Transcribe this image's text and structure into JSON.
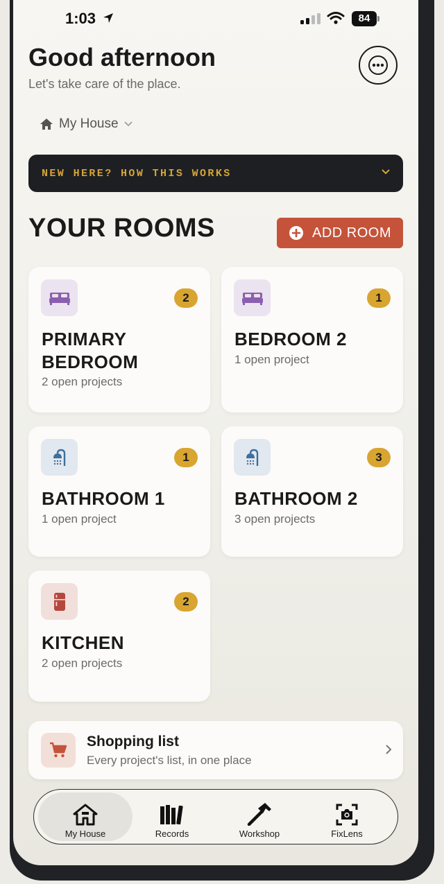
{
  "status_bar": {
    "time": "1:03",
    "battery": "84"
  },
  "header": {
    "greeting": "Good afternoon",
    "subtitle": "Let's take care of the place."
  },
  "house_selector": {
    "label": "My House"
  },
  "banner": {
    "text": "NEW HERE? HOW THIS WORKS"
  },
  "rooms_section": {
    "title": "YOUR ROOMS",
    "add_label": "ADD ROOM"
  },
  "rooms": [
    {
      "name": "PRIMARY BEDROOM",
      "subtitle": "2 open projects",
      "count": "2",
      "icon": "bed-icon",
      "icon_bg": "#ebe3ef",
      "icon_color": "#8b5fb0"
    },
    {
      "name": "BEDROOM 2",
      "subtitle": "1 open project",
      "count": "1",
      "icon": "bed-icon",
      "icon_bg": "#ebe3ef",
      "icon_color": "#8b5fb0"
    },
    {
      "name": "BATHROOM 1",
      "subtitle": "1 open project",
      "count": "1",
      "icon": "shower-icon",
      "icon_bg": "#e1e8ef",
      "icon_color": "#3d6f9e"
    },
    {
      "name": "BATHROOM 2",
      "subtitle": "3 open projects",
      "count": "3",
      "icon": "shower-icon",
      "icon_bg": "#e1e8ef",
      "icon_color": "#3d6f9e"
    },
    {
      "name": "KITCHEN",
      "subtitle": "2 open projects",
      "count": "2",
      "icon": "refrigerator-icon",
      "icon_bg": "#f1dfdc",
      "icon_color": "#b6473d"
    }
  ],
  "shopping": {
    "title": "Shopping list",
    "subtitle": "Every project's list, in one place"
  },
  "tabs": [
    {
      "label": "My House",
      "icon": "house-icon",
      "active": true
    },
    {
      "label": "Records",
      "icon": "books-icon",
      "active": false
    },
    {
      "label": "Workshop",
      "icon": "hammer-icon",
      "active": false
    },
    {
      "label": "FixLens",
      "icon": "camera-scan-icon",
      "active": false
    }
  ],
  "colors": {
    "accent": "#c4533a",
    "badge": "#d8a531",
    "banner_bg": "#1d1f22",
    "banner_text": "#d5a437"
  }
}
